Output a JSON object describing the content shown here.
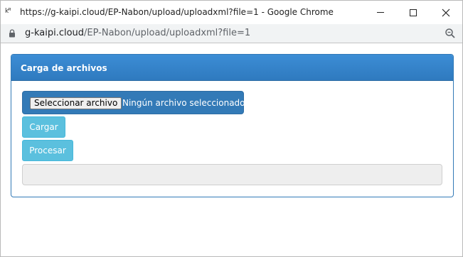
{
  "window": {
    "app_icon_text": "kᴾᴵ",
    "title": "https://g-kaipi.cloud/EP-Nabon/upload/uploadxml?file=1 - Google Chrome",
    "minimize_icon": "minimize-icon",
    "maximize_icon": "maximize-icon",
    "close_icon": "close-icon"
  },
  "addressbar": {
    "host": "g-kaipi.cloud",
    "path": "/EP-Nabon/upload/uploadxml?file=1",
    "lock_icon": "lock-icon",
    "zoom_icon": "zoom-icon"
  },
  "panel": {
    "title": "Carga de archivos"
  },
  "file_input": {
    "button_label": "Seleccionar archivo",
    "status": "Ningún archivo seleccionado"
  },
  "buttons": {
    "cargar": "Cargar",
    "procesar": "Procesar"
  },
  "progress": {
    "value": 0
  },
  "colors": {
    "primary": "#337ab7",
    "info": "#5bc0de",
    "progress_track": "#eeeeee"
  }
}
